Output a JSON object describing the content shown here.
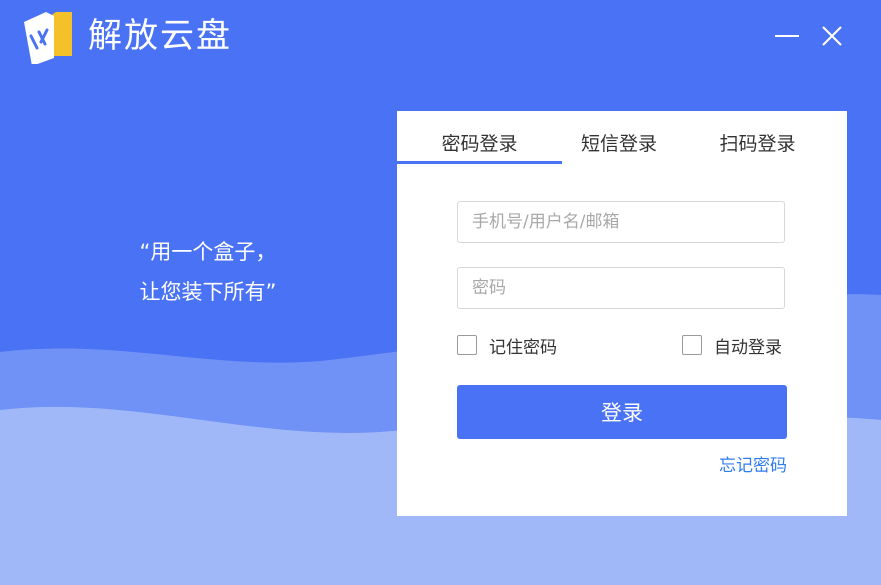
{
  "app": {
    "title": "解放云盘",
    "logo_icon": "folder-logo-icon"
  },
  "window_controls": {
    "minimize_icon": "minimize-icon",
    "close_icon": "close-icon"
  },
  "slogan": {
    "line1": "“用一个盒子，",
    "line2": "让您装下所有”"
  },
  "login": {
    "tabs": [
      {
        "label": "密码登录",
        "active": true
      },
      {
        "label": "短信登录",
        "active": false
      },
      {
        "label": "扫码登录",
        "active": false
      }
    ],
    "username": {
      "value": "",
      "placeholder": "手机号/用户名/邮箱"
    },
    "password": {
      "value": "",
      "placeholder": "密码"
    },
    "remember": {
      "label": "记住密码",
      "checked": false
    },
    "auto_login": {
      "label": "自动登录",
      "checked": false
    },
    "submit_label": "登录",
    "forgot_label": "忘记密码"
  },
  "colors": {
    "primary": "#4a72f4",
    "link": "#2f7cf0",
    "logo_yellow": "#f5c12a"
  }
}
